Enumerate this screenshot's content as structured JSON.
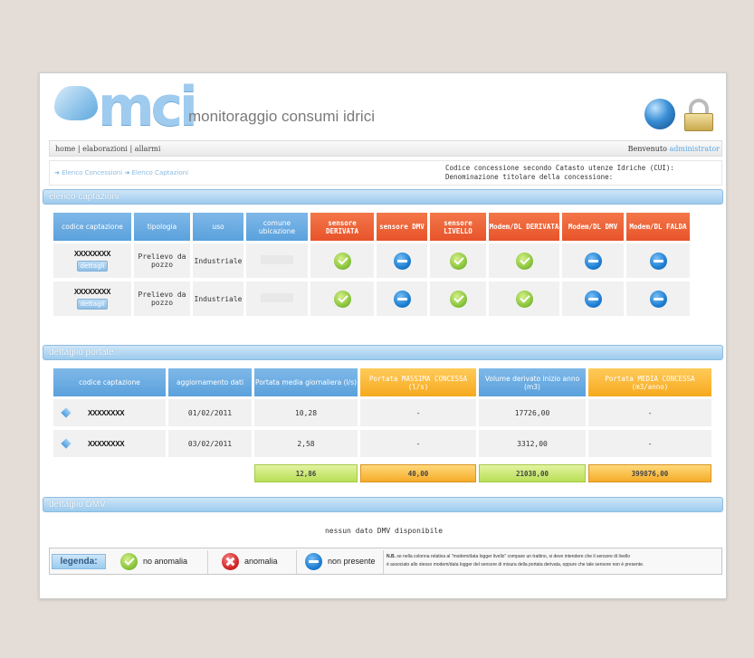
{
  "header": {
    "logo_text": "mci",
    "subtitle": "monitoraggio consumi idrici"
  },
  "navbar": {
    "home": "home",
    "elaborazioni": "elaborazioni",
    "allarmi": "allarmi",
    "separator": "|",
    "welcome": "Benvenuto",
    "user": "administrator"
  },
  "breadcrumb": {
    "item1": "Elenco Concessioni",
    "item2": "Elenco Captazioni"
  },
  "concession_info": {
    "line1": "Codice concessione secondo Catasto utenze Idriche (CUI):",
    "line2": "Denominazione titolare della concessione:"
  },
  "captazioni": {
    "title": "elenco captazioni",
    "headers": [
      "codice captazione",
      "tipologia",
      "uso",
      "comune ubicazione",
      "sensore DERIVATA",
      "sensore DMV",
      "sensore LIVELLO",
      "Modem/DL DERIVATA",
      "Modem/DL DMV",
      "Modem/DL FALDA"
    ],
    "rows": [
      {
        "codice": "XXXXXXXX",
        "button": "dettagli",
        "tipologia": "Prelievo da pozzo",
        "uso": "Industriale",
        "status": [
          "ok",
          "np",
          "ok",
          "ok",
          "np",
          "np"
        ]
      },
      {
        "codice": "XXXXXXXX",
        "button": "dettagli",
        "tipologia": "Prelievo da pozzo",
        "uso": "Industriale",
        "status": [
          "ok",
          "np",
          "ok",
          "ok",
          "np",
          "np"
        ]
      }
    ]
  },
  "portate": {
    "title": "dettaglio portate",
    "headers": [
      "codice captazione",
      "aggiornamento dati",
      "Portata media giornaliera (l/s)",
      "Portata MASSIMA CONCESSA (l/s)",
      "Volume derivato inizio anno (m3)",
      "Portata MEDIA CONCESSA (m3/anno)"
    ],
    "rows": [
      {
        "codice": "XXXXXXXX",
        "data": "01/02/2011",
        "media": "10,28",
        "massima": "-",
        "volume": "17726,00",
        "media_concessa": "-"
      },
      {
        "codice": "XXXXXXXX",
        "data": "03/02/2011",
        "media": "2,58",
        "massima": "-",
        "volume": "3312,00",
        "media_concessa": "-"
      }
    ],
    "totals": {
      "media": "12,86",
      "massima": "40,00",
      "volume": "21038,00",
      "media_concessa": "399876,00"
    }
  },
  "dmv": {
    "title": "dettaglio DMV",
    "message": "nessun dato DMV disponibile"
  },
  "legend": {
    "title": "legenda:",
    "no_anomalia": "no anomalia",
    "anomalia": "anomalia",
    "non_presente": "non presente",
    "note_label": "N.B.",
    "note_line1": "se nella colonna relativa al \"modem/data logger livello\" compare un trattino, si deve intendere che il sensore di livello",
    "note_line2": "è associato allo stesso modem/data logger del sensore di misura della portata derivata, oppure che tale sensore non è presente."
  },
  "colors": {
    "accent_blue": "#5aa1dc",
    "sensor_orange": "#e8532b",
    "concession_yellow": "#f6a91e",
    "ok_green": "#8cc63e",
    "error_red": "#d3282a"
  }
}
